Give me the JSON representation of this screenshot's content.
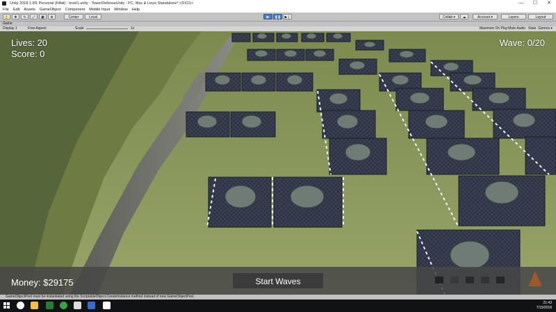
{
  "window": {
    "title": "Unity 2018.1.9f1 Personal (64bit) - level1.unity - TowerDefenseUnity - PC, Mac & Linux Standalone* <DX11>",
    "controls": [
      "—",
      "☐",
      "✕"
    ]
  },
  "menu": [
    "File",
    "Edit",
    "Assets",
    "GameObject",
    "Component",
    "Mobile Input",
    "Window",
    "Help"
  ],
  "toolbar": {
    "pivot_label": "Center",
    "space_label": "Local",
    "collab_label": "Collab ▾",
    "account_label": "Account ▾",
    "layers_label": "Layers",
    "layout_label": "Layout"
  },
  "game_view": {
    "tab_label": "Game",
    "display_label": "Display 1",
    "aspect_label": "Free Aspect",
    "scale_label": "Scale",
    "scale_value": "1x",
    "toggles": [
      "Maximize On Play",
      "Mute Audio",
      "Stats",
      "Gizmos ▾"
    ]
  },
  "hud": {
    "lives": "Lives: 20",
    "score": "Score: 0",
    "wave": "Wave: 0/20",
    "money": "Money: $29175",
    "start_button": "Start Waves"
  },
  "status_bar": {
    "message": "GameObjectPool must be instantiated using the ScriptableObject.CreateInstance method instead of new GameObjectPool."
  },
  "taskbar": {
    "time": "21:43",
    "date": "7/15/2018"
  },
  "colors": {
    "grass": "#8a9a5a",
    "wall": "#6b6e66",
    "platform": "#2c3140",
    "light_strip": "#e9f2ff",
    "hud_panel": "#464646"
  },
  "icons": [
    "play-icon",
    "pause-icon",
    "step-icon",
    "hand-tool-icon",
    "move-tool-icon",
    "rotate-tool-icon",
    "scale-tool-icon",
    "rect-tool-icon",
    "transform-tool-icon",
    "cloud-icon",
    "windows-start-icon",
    "search-icon",
    "chrome-icon",
    "file-explorer-icon",
    "unity-icon"
  ]
}
